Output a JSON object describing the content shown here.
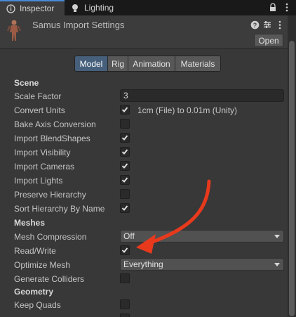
{
  "tabs": {
    "inspector": "Inspector",
    "lighting": "Lighting"
  },
  "header": {
    "title": "Samus Import Settings",
    "open_label": "Open"
  },
  "main_tabs": [
    "Model",
    "Rig",
    "Animation",
    "Materials"
  ],
  "selected_tab": "Model",
  "sections": {
    "scene": "Scene",
    "meshes": "Meshes",
    "geometry": "Geometry"
  },
  "fields": {
    "scale_factor": {
      "label": "Scale Factor",
      "value": "3"
    },
    "convert_units": {
      "label": "Convert Units",
      "checked": true,
      "note": "1cm (File) to 0.01m (Unity)"
    },
    "bake_axis": {
      "label": "Bake Axis Conversion",
      "checked": false
    },
    "import_blendshapes": {
      "label": "Import BlendShapes",
      "checked": true
    },
    "import_visibility": {
      "label": "Import Visibility",
      "checked": true
    },
    "import_cameras": {
      "label": "Import Cameras",
      "checked": true
    },
    "import_lights": {
      "label": "Import Lights",
      "checked": true
    },
    "preserve_hierarchy": {
      "label": "Preserve Hierarchy",
      "checked": false
    },
    "sort_hierarchy": {
      "label": "Sort Hierarchy By Name",
      "checked": true
    },
    "mesh_compression": {
      "label": "Mesh Compression",
      "value": "Off"
    },
    "read_write": {
      "label": "Read/Write",
      "checked": true
    },
    "optimize_mesh": {
      "label": "Optimize Mesh",
      "value": "Everything"
    },
    "generate_colliders": {
      "label": "Generate Colliders",
      "checked": false
    },
    "keep_quads": {
      "label": "Keep Quads",
      "checked": false
    }
  },
  "colors": {
    "background": "#383838",
    "selected_tab": "#46607c",
    "annotation_arrow": "#e8391d"
  }
}
